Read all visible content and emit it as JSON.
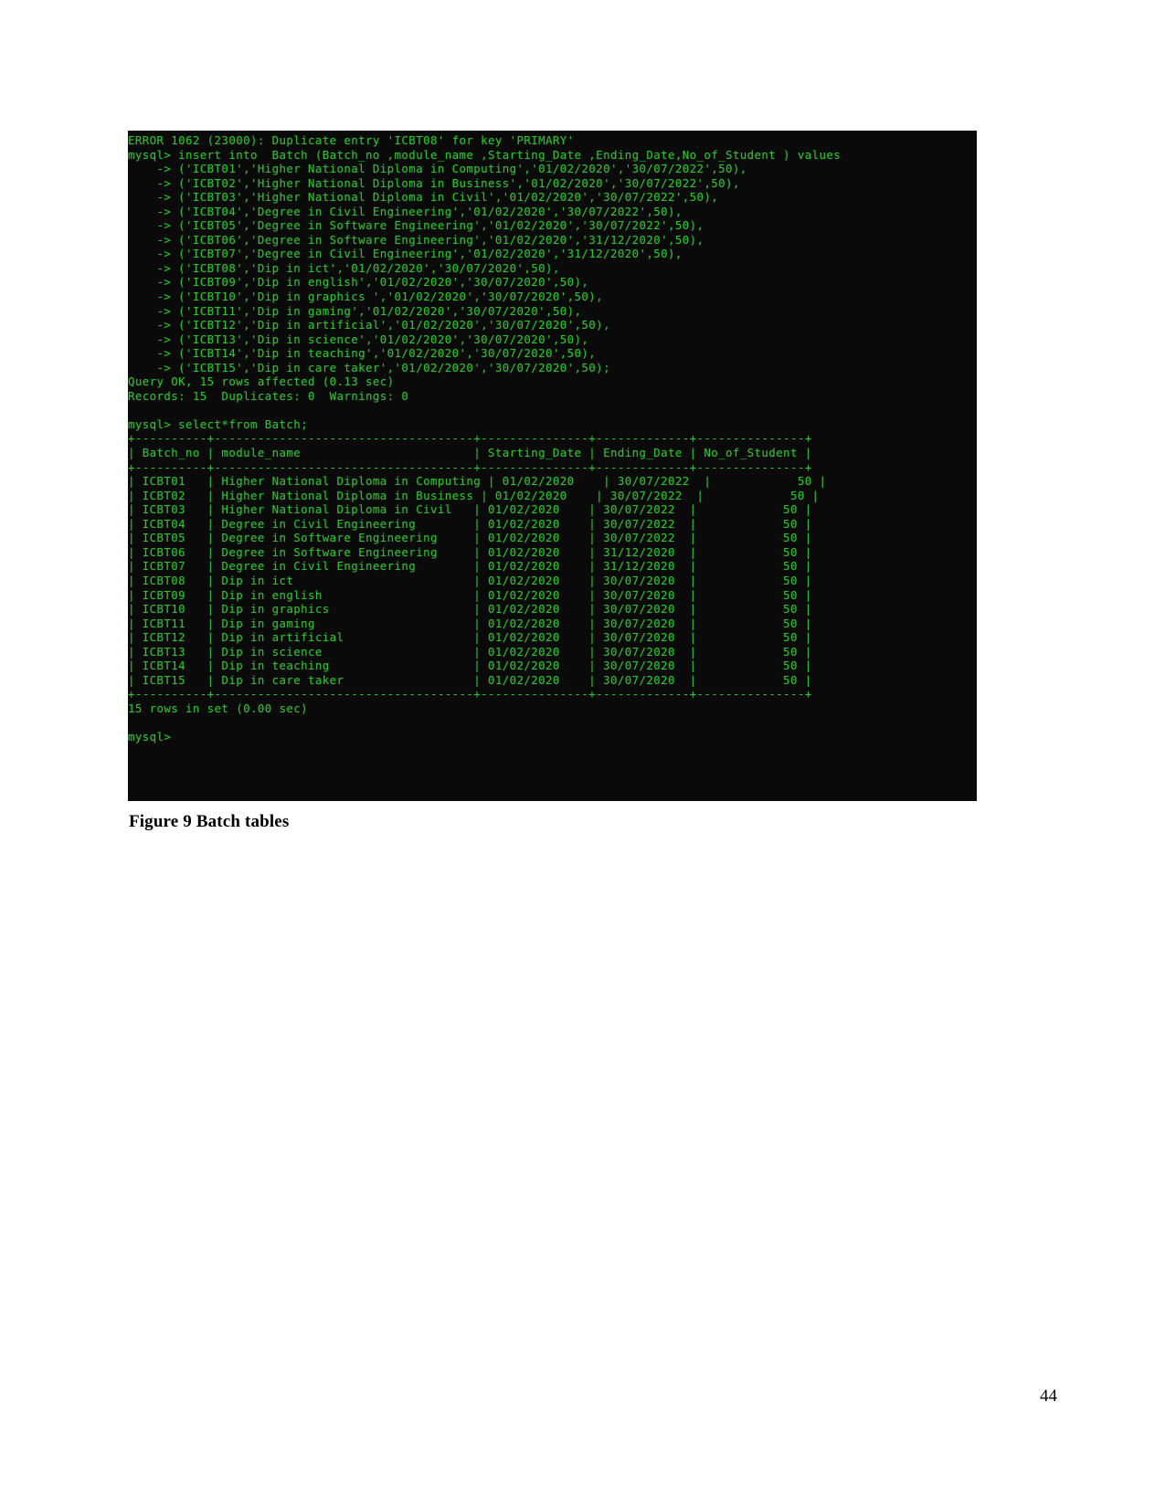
{
  "document": {
    "caption": "Figure 9 Batch tables",
    "page_number": "44"
  },
  "terminal": {
    "background_color": "#0a0a0a",
    "text_color": "#2fbf2f",
    "lines": [
      "ERROR 1062 (23000): Duplicate entry 'ICBT08' for key 'PRIMARY'",
      "mysql> insert into  Batch (Batch_no ,module_name ,Starting_Date ,Ending_Date,No_of_Student ) values",
      "    -> ('ICBT01','Higher National Diploma in Computing','01/02/2020','30/07/2022',50),",
      "    -> ('ICBT02','Higher National Diploma in Business','01/02/2020','30/07/2022',50),",
      "    -> ('ICBT03','Higher National Diploma in Civil','01/02/2020','30/07/2022',50),",
      "    -> ('ICBT04','Degree in Civil Engineering','01/02/2020','30/07/2022',50),",
      "    -> ('ICBT05','Degree in Software Engineering','01/02/2020','30/07/2022',50),",
      "    -> ('ICBT06','Degree in Software Engineering','01/02/2020','31/12/2020',50),",
      "    -> ('ICBT07','Degree in Civil Engineering','01/02/2020','31/12/2020',50),",
      "    -> ('ICBT08','Dip in ict','01/02/2020','30/07/2020',50),",
      "    -> ('ICBT09','Dip in english','01/02/2020','30/07/2020',50),",
      "    -> ('ICBT10','Dip in graphics ','01/02/2020','30/07/2020',50),",
      "    -> ('ICBT11','Dip in gaming','01/02/2020','30/07/2020',50),",
      "    -> ('ICBT12','Dip in artificial','01/02/2020','30/07/2020',50),",
      "    -> ('ICBT13','Dip in science','01/02/2020','30/07/2020',50),",
      "    -> ('ICBT14','Dip in teaching','01/02/2020','30/07/2020',50),",
      "    -> ('ICBT15','Dip in care taker','01/02/2020','30/07/2020',50);",
      "Query OK, 15 rows affected (0.13 sec)",
      "Records: 15  Duplicates: 0  Warnings: 0",
      "",
      "mysql> select*from Batch;",
      "+----------+------------------------------------+---------------+-------------+---------------+",
      "| Batch_no | module_name                        | Starting_Date | Ending_Date | No_of_Student |",
      "+----------+------------------------------------+---------------+-------------+---------------+",
      "| ICBT01   | Higher National Diploma in Computing | 01/02/2020    | 30/07/2022  |            50 |",
      "| ICBT02   | Higher National Diploma in Business | 01/02/2020    | 30/07/2022  |            50 |",
      "| ICBT03   | Higher National Diploma in Civil   | 01/02/2020    | 30/07/2022  |            50 |",
      "| ICBT04   | Degree in Civil Engineering        | 01/02/2020    | 30/07/2022  |            50 |",
      "| ICBT05   | Degree in Software Engineering     | 01/02/2020    | 30/07/2022  |            50 |",
      "| ICBT06   | Degree in Software Engineering     | 01/02/2020    | 31/12/2020  |            50 |",
      "| ICBT07   | Degree in Civil Engineering        | 01/02/2020    | 31/12/2020  |            50 |",
      "| ICBT08   | Dip in ict                         | 01/02/2020    | 30/07/2020  |            50 |",
      "| ICBT09   | Dip in english                     | 01/02/2020    | 30/07/2020  |            50 |",
      "| ICBT10   | Dip in graphics                    | 01/02/2020    | 30/07/2020  |            50 |",
      "| ICBT11   | Dip in gaming                      | 01/02/2020    | 30/07/2020  |            50 |",
      "| ICBT12   | Dip in artificial                  | 01/02/2020    | 30/07/2020  |            50 |",
      "| ICBT13   | Dip in science                     | 01/02/2020    | 30/07/2020  |            50 |",
      "| ICBT14   | Dip in teaching                    | 01/02/2020    | 30/07/2020  |            50 |",
      "| ICBT15   | Dip in care taker                  | 01/02/2020    | 30/07/2020  |            50 |",
      "+----------+------------------------------------+---------------+-------------+---------------+",
      "15 rows in set (0.00 sec)",
      "",
      "mysql>"
    ],
    "result_table": {
      "columns": [
        "Batch_no",
        "module_name",
        "Starting_Date",
        "Ending_Date",
        "No_of_Student"
      ],
      "rows": [
        [
          "ICBT01",
          "Higher National Diploma in Computing",
          "01/02/2020",
          "30/07/2022",
          "50"
        ],
        [
          "ICBT02",
          "Higher National Diploma in Business",
          "01/02/2020",
          "30/07/2022",
          "50"
        ],
        [
          "ICBT03",
          "Higher National Diploma in Civil",
          "01/02/2020",
          "30/07/2022",
          "50"
        ],
        [
          "ICBT04",
          "Degree in Civil Engineering",
          "01/02/2020",
          "30/07/2022",
          "50"
        ],
        [
          "ICBT05",
          "Degree in Software Engineering",
          "01/02/2020",
          "30/07/2022",
          "50"
        ],
        [
          "ICBT06",
          "Degree in Software Engineering",
          "01/02/2020",
          "31/12/2020",
          "50"
        ],
        [
          "ICBT07",
          "Degree in Civil Engineering",
          "01/02/2020",
          "31/12/2020",
          "50"
        ],
        [
          "ICBT08",
          "Dip in ict",
          "01/02/2020",
          "30/07/2020",
          "50"
        ],
        [
          "ICBT09",
          "Dip in english",
          "01/02/2020",
          "30/07/2020",
          "50"
        ],
        [
          "ICBT10",
          "Dip in graphics",
          "01/02/2020",
          "30/07/2020",
          "50"
        ],
        [
          "ICBT11",
          "Dip in gaming",
          "01/02/2020",
          "30/07/2020",
          "50"
        ],
        [
          "ICBT12",
          "Dip in artificial",
          "01/02/2020",
          "30/07/2020",
          "50"
        ],
        [
          "ICBT13",
          "Dip in science",
          "01/02/2020",
          "30/07/2020",
          "50"
        ],
        [
          "ICBT14",
          "Dip in teaching",
          "01/02/2020",
          "30/07/2020",
          "50"
        ],
        [
          "ICBT15",
          "Dip in care taker",
          "01/02/2020",
          "30/07/2020",
          "50"
        ]
      ],
      "footer": "15 rows in set (0.00 sec)"
    }
  }
}
